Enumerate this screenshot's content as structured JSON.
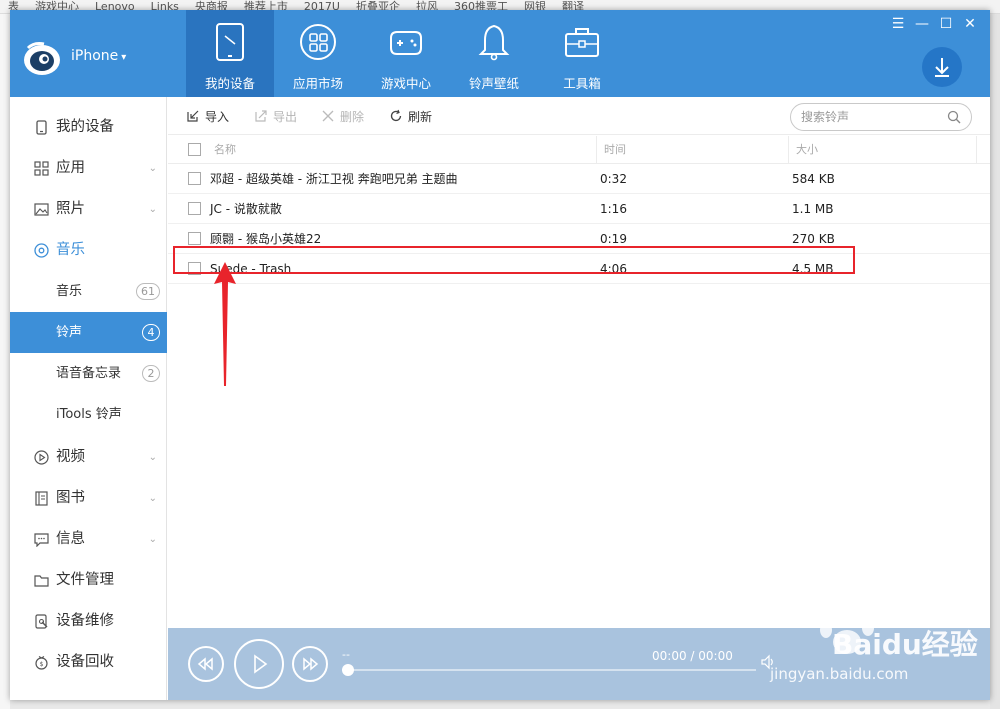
{
  "browser_bar": {
    "items": [
      "表",
      "游戏中心",
      "Lenovo",
      "Links",
      "央商报",
      "推荐上市",
      "2017U",
      "折叠亚企",
      "拉风",
      "360推票工",
      "网银",
      "翻译"
    ]
  },
  "app": {
    "device_name": "iPhone",
    "device_caret": "▾",
    "window_controls": [
      "☰",
      "—",
      "☐",
      "✕"
    ]
  },
  "nav": {
    "tabs": [
      {
        "label": "我的设备",
        "icon": "tablet-icon",
        "active": true
      },
      {
        "label": "应用市场",
        "icon": "apps-grid-icon",
        "active": false
      },
      {
        "label": "游戏中心",
        "icon": "gamepad-icon",
        "active": false
      },
      {
        "label": "铃声壁纸",
        "icon": "bell-icon",
        "active": false
      },
      {
        "label": "工具箱",
        "icon": "toolbox-icon",
        "active": false
      }
    ]
  },
  "sidebar": {
    "items": [
      {
        "label": "我的设备",
        "icon": "device-icon",
        "has_arrow": false
      },
      {
        "label": "应用",
        "icon": "apps-icon",
        "has_arrow": true
      },
      {
        "label": "照片",
        "icon": "photo-icon",
        "has_arrow": true
      },
      {
        "label": "音乐",
        "icon": "music-icon",
        "has_arrow": true,
        "accent": true
      }
    ],
    "music_sub": [
      {
        "label": "音乐",
        "count": "61",
        "active": false
      },
      {
        "label": "铃声",
        "count": "4",
        "active": true
      },
      {
        "label": "语音备忘录",
        "count": "2",
        "active": false
      },
      {
        "label": "iTools 铃声",
        "count": "",
        "active": false
      }
    ],
    "items_bottom": [
      {
        "label": "视频",
        "icon": "video-icon",
        "has_arrow": true
      },
      {
        "label": "图书",
        "icon": "book-icon",
        "has_arrow": true
      },
      {
        "label": "信息",
        "icon": "message-icon",
        "has_arrow": true
      },
      {
        "label": "文件管理",
        "icon": "folder-icon",
        "has_arrow": false
      },
      {
        "label": "设备维修",
        "icon": "repair-icon",
        "has_arrow": false
      },
      {
        "label": "设备回收",
        "icon": "recycle-icon",
        "has_arrow": false
      }
    ],
    "arrow_glyph": "⌄"
  },
  "toolbar": {
    "import_label": "导入",
    "export_label": "导出",
    "delete_label": "删除",
    "refresh_label": "刷新",
    "search_placeholder": "搜索铃声"
  },
  "table": {
    "headers": {
      "name": "名称",
      "time": "时间",
      "size": "大小"
    },
    "rows": [
      {
        "name": "邓超 - 超级英雄 - 浙江卫视 奔跑吧兄弟 主题曲",
        "time": "0:32",
        "size": "584 KB"
      },
      {
        "name": "JC - 说散就散",
        "time": "1:16",
        "size": "1.1 MB"
      },
      {
        "name": "顾翾 - 猴岛小英雄22",
        "time": "0:19",
        "size": "270 KB"
      },
      {
        "name": "Suede - Trash",
        "time": "4:06",
        "size": "4.5 MB"
      }
    ]
  },
  "player": {
    "time": "00:00 / 00:00",
    "title_dash": "--",
    "progress": 0
  },
  "watermark": {
    "brand": "Baidu经验",
    "url": "jingyan.baidu.com"
  },
  "colors": {
    "accent": "#3d8fd8",
    "accent_dark": "#2a74bf",
    "highlight": "#e8242b",
    "player_bg": "#a9c3de"
  }
}
